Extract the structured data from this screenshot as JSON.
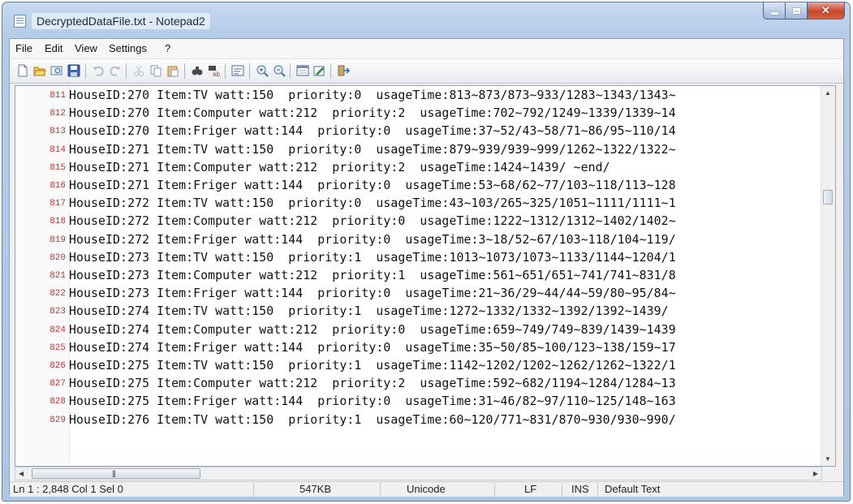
{
  "window": {
    "title": "DecryptedDataFile.txt - Notepad2"
  },
  "menu": [
    "File",
    "Edit",
    "View",
    "Settings",
    "?"
  ],
  "toolbar_icons": [
    "new-icon",
    "open-icon",
    "browse-icon",
    "save-icon",
    "undo-icon",
    "redo-icon",
    "cut-icon",
    "copy-icon",
    "paste-icon",
    "find-icon",
    "replace-icon",
    "word-wrap-icon",
    "zoom-in-icon",
    "zoom-out-icon",
    "scheme-icon",
    "customize-icon",
    "exit-icon"
  ],
  "editor": {
    "lines": [
      {
        "num": "811",
        "text": "HouseID:270 Item:TV watt:150  priority:0  usageTime:813~873/873~933/1283~1343/1343~"
      },
      {
        "num": "812",
        "text": "HouseID:270 Item:Computer watt:212  priority:2  usageTime:702~792/1249~1339/1339~14"
      },
      {
        "num": "813",
        "text": "HouseID:270 Item:Friger watt:144  priority:0  usageTime:37~52/43~58/71~86/95~110/14"
      },
      {
        "num": "814",
        "text": "HouseID:271 Item:TV watt:150  priority:0  usageTime:879~939/939~999/1262~1322/1322~"
      },
      {
        "num": "815",
        "text": "HouseID:271 Item:Computer watt:212  priority:2  usageTime:1424~1439/ ~end/"
      },
      {
        "num": "816",
        "text": "HouseID:271 Item:Friger watt:144  priority:0  usageTime:53~68/62~77/103~118/113~128"
      },
      {
        "num": "817",
        "text": "HouseID:272 Item:TV watt:150  priority:0  usageTime:43~103/265~325/1051~1111/1111~1"
      },
      {
        "num": "818",
        "text": "HouseID:272 Item:Computer watt:212  priority:0  usageTime:1222~1312/1312~1402/1402~"
      },
      {
        "num": "819",
        "text": "HouseID:272 Item:Friger watt:144  priority:0  usageTime:3~18/52~67/103~118/104~119/"
      },
      {
        "num": "820",
        "text": "HouseID:273 Item:TV watt:150  priority:1  usageTime:1013~1073/1073~1133/1144~1204/1"
      },
      {
        "num": "821",
        "text": "HouseID:273 Item:Computer watt:212  priority:1  usageTime:561~651/651~741/741~831/8"
      },
      {
        "num": "822",
        "text": "HouseID:273 Item:Friger watt:144  priority:0  usageTime:21~36/29~44/44~59/80~95/84~"
      },
      {
        "num": "823",
        "text": "HouseID:274 Item:TV watt:150  priority:1  usageTime:1272~1332/1332~1392/1392~1439/"
      },
      {
        "num": "824",
        "text": "HouseID:274 Item:Computer watt:212  priority:0  usageTime:659~749/749~839/1439~1439"
      },
      {
        "num": "825",
        "text": "HouseID:274 Item:Friger watt:144  priority:0  usageTime:35~50/85~100/123~138/159~17"
      },
      {
        "num": "826",
        "text": "HouseID:275 Item:TV watt:150  priority:1  usageTime:1142~1202/1202~1262/1262~1322/1"
      },
      {
        "num": "827",
        "text": "HouseID:275 Item:Computer watt:212  priority:2  usageTime:592~682/1194~1284/1284~13"
      },
      {
        "num": "828",
        "text": "HouseID:275 Item:Friger watt:144  priority:0  usageTime:31~46/82~97/110~125/148~163"
      },
      {
        "num": "829",
        "text": "HouseID:276 Item:TV watt:150  priority:1  usageTime:60~120/771~831/870~930/930~990/"
      }
    ]
  },
  "status": {
    "position": "Ln 1 : 2,848   Col 1   Sel 0",
    "size": "547KB",
    "encoding": "Unicode",
    "eol": "LF",
    "mode": "INS",
    "scheme": "Default Text"
  }
}
